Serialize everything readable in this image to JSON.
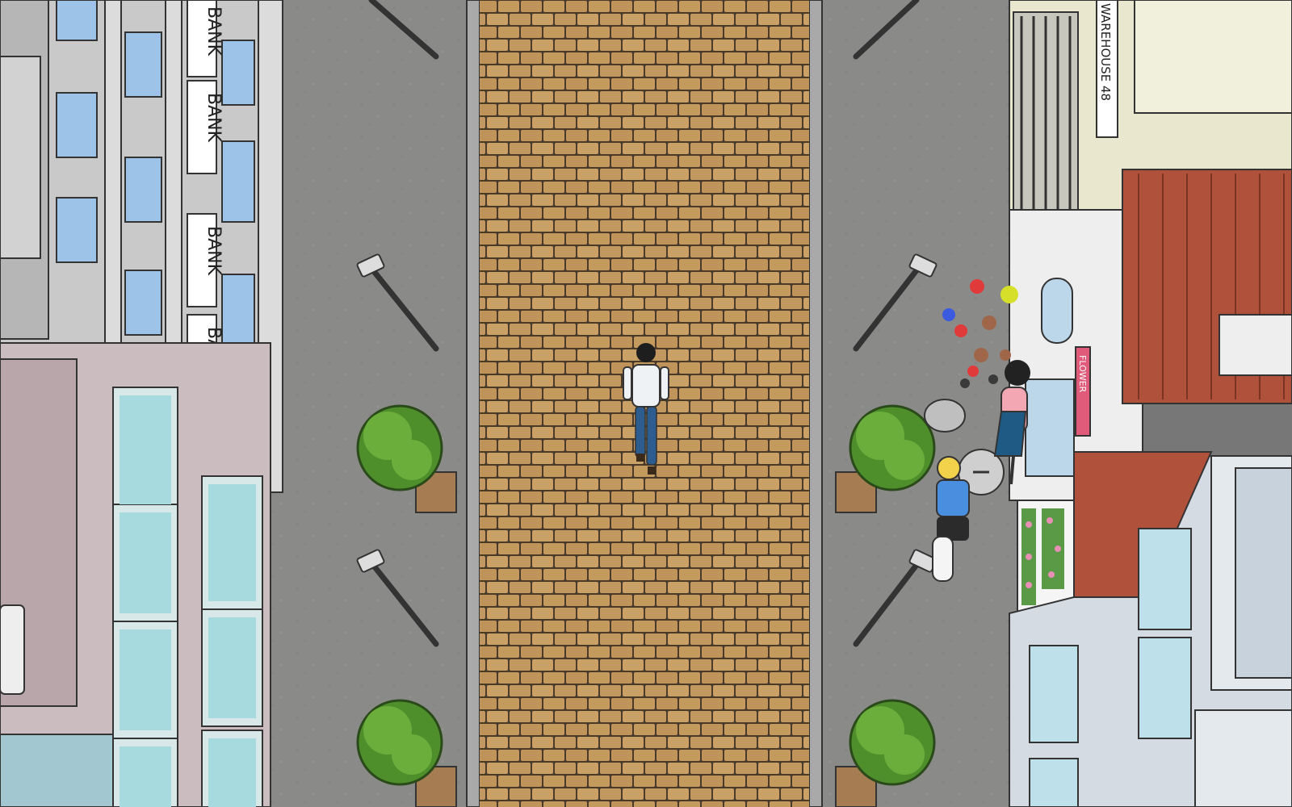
{
  "scene": {
    "type": "top-down street scene",
    "street_style": "brick pedestrian road with sidewalks"
  },
  "signs": {
    "bank_1": "BANK",
    "bank_2": "BANK",
    "bank_3": "BANK",
    "bank_4": "BANK",
    "warehouse": "WAREHOUSE 48",
    "shop": "FLOWER"
  },
  "colors": {
    "asphalt": "#8a8a88",
    "bricks": "#c59a5f",
    "mortar": "#4a3a2a",
    "tree": "#6cae3c",
    "roof": "#b0513c",
    "bank_building": "#c9c9c9",
    "pink_building": "#cbbcbf",
    "cream_building": "#e9e8cf",
    "blue_building": "#d4dbe3"
  },
  "icons": {
    "person": "walking-man",
    "tree": "tree",
    "lamp": "street-lamp",
    "trash": "trash-can",
    "skater": "skateboarder",
    "woman": "woman-with-phone",
    "flowers": "scattered-flowers"
  }
}
